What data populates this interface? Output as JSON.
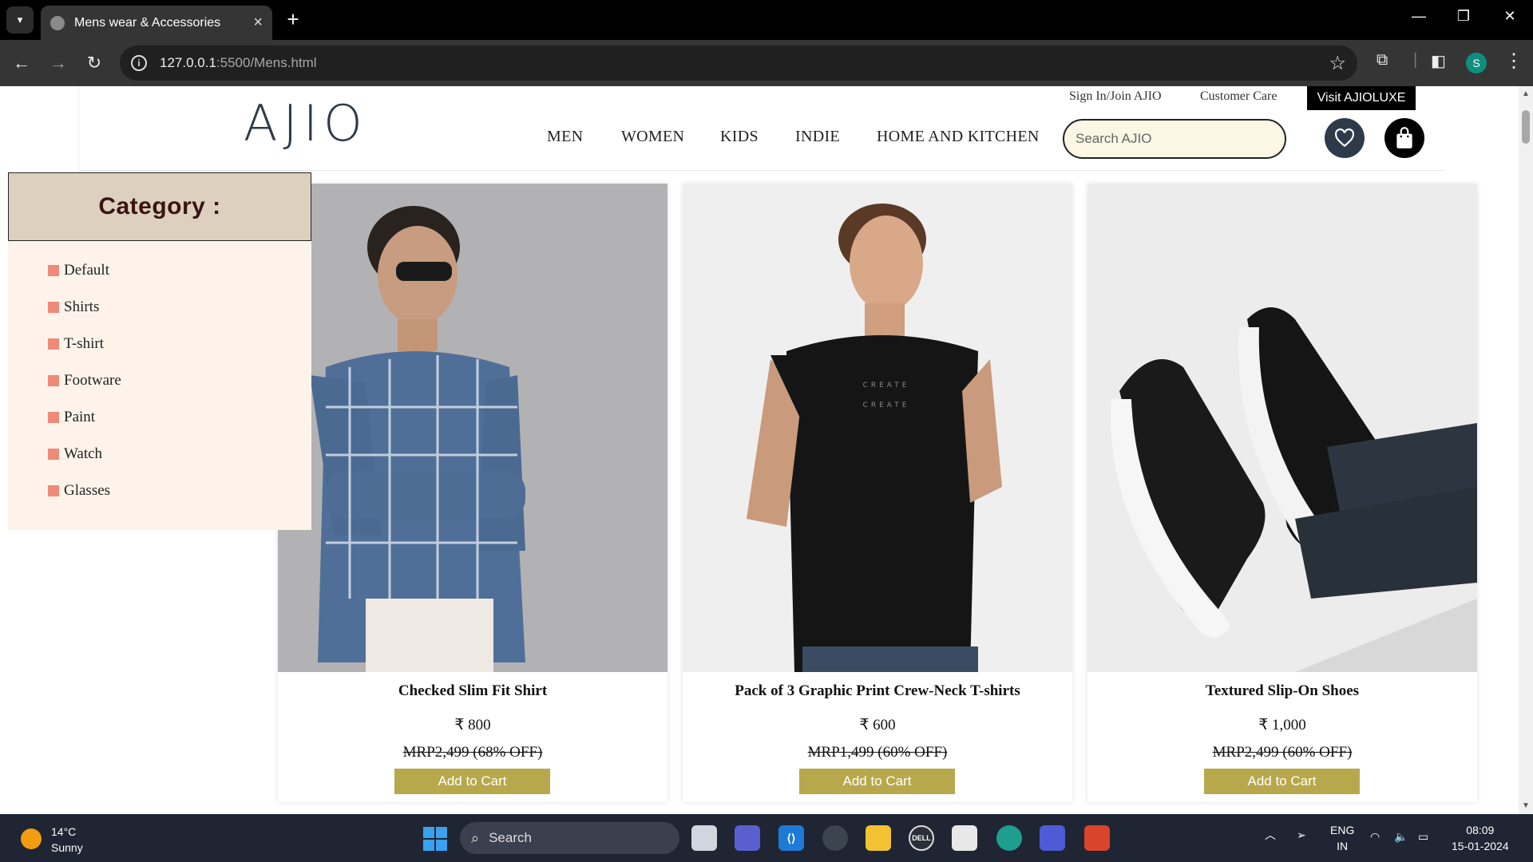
{
  "browser": {
    "tab_title": "Mens wear & Accessories",
    "url_host": "127.0.0.1",
    "url_rest": ":5500/Mens.html"
  },
  "header": {
    "logo": "AJIO",
    "top_links": [
      "Sign In/Join AJIO",
      "Customer Care"
    ],
    "luxe_button": "Visit AJIOLUXE",
    "nav": [
      "MEN",
      "WOMEN",
      "KIDS",
      "INDIE",
      "HOME AND KITCHEN"
    ],
    "search_placeholder": "Search AJIO"
  },
  "sidebar": {
    "heading": "Category :",
    "items": [
      "Default",
      "Shirts",
      "T-shirt",
      "Footware",
      "Paint",
      "Watch",
      "Glasses"
    ]
  },
  "products": [
    {
      "name": "Checked Slim Fit Shirt",
      "price": "₹ 800",
      "mrp": "MRP2,499 (68% OFF)",
      "button": "Add to Cart"
    },
    {
      "name": "Pack of 3 Graphic Print Crew-Neck T-shirts",
      "price": "₹ 600",
      "mrp": "MRP1,499 (60% OFF)",
      "button": "Add to Cart"
    },
    {
      "name": "Textured Slip-On Shoes",
      "price": "₹ 1,000",
      "mrp": "MRP2,499 (60% OFF)",
      "button": "Add to Cart"
    }
  ],
  "taskbar": {
    "weather_temp": "14°C",
    "weather_desc": "Sunny",
    "search_label": "Search",
    "lang1": "ENG",
    "lang2": "IN",
    "time": "08:09",
    "date": "15-01-2024"
  },
  "profile_initial": "S"
}
